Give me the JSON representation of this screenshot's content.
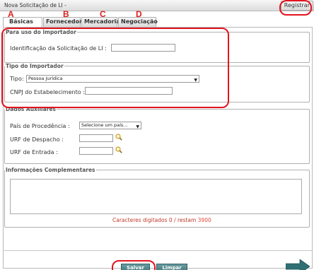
{
  "window": {
    "title": "Nova Solicitação de LI -",
    "register_label": "Registrar"
  },
  "annotations": {
    "letters": [
      "A",
      "B",
      "C",
      "D"
    ]
  },
  "tabs": [
    {
      "label": "Básicas",
      "active": true
    },
    {
      "label": "Fornecedor",
      "active": false
    },
    {
      "label": "Mercadoria",
      "active": false
    },
    {
      "label": "Negociação",
      "active": false
    }
  ],
  "importer_use": {
    "legend": "Para uso do importador",
    "request_id_label": "Identificação da Solicitação de LI :",
    "request_id_value": ""
  },
  "importer_type": {
    "legend": "Tipo do Importador",
    "type_label": "Tipo:",
    "type_value": "Pessoa Jurídica",
    "cnpj_label": "CNPJ do Estabelecimento :",
    "cnpj_value": ""
  },
  "aux": {
    "legend": "Dados Auxiliares",
    "country_label": "País de Procedência :",
    "country_value": "Selecione um país...",
    "dispatch_label": "URF de Despacho :",
    "dispatch_value": "",
    "entry_label": "URF de Entrada :",
    "entry_value": ""
  },
  "complementary": {
    "legend": "Informações Complementares",
    "text": "",
    "counter_prefix": "Caracteres digitados",
    "typed": "0",
    "separator": "/ restam",
    "remaining": "3900"
  },
  "actions": {
    "save_label": "Salvar",
    "clear_label": "Limpar"
  },
  "colors": {
    "highlight": "#e3141f",
    "button": "#3f7478",
    "arrow": "#2f6f73"
  },
  "icons": {
    "lookup": "magnifier-icon",
    "next": "arrow-right-icon"
  }
}
